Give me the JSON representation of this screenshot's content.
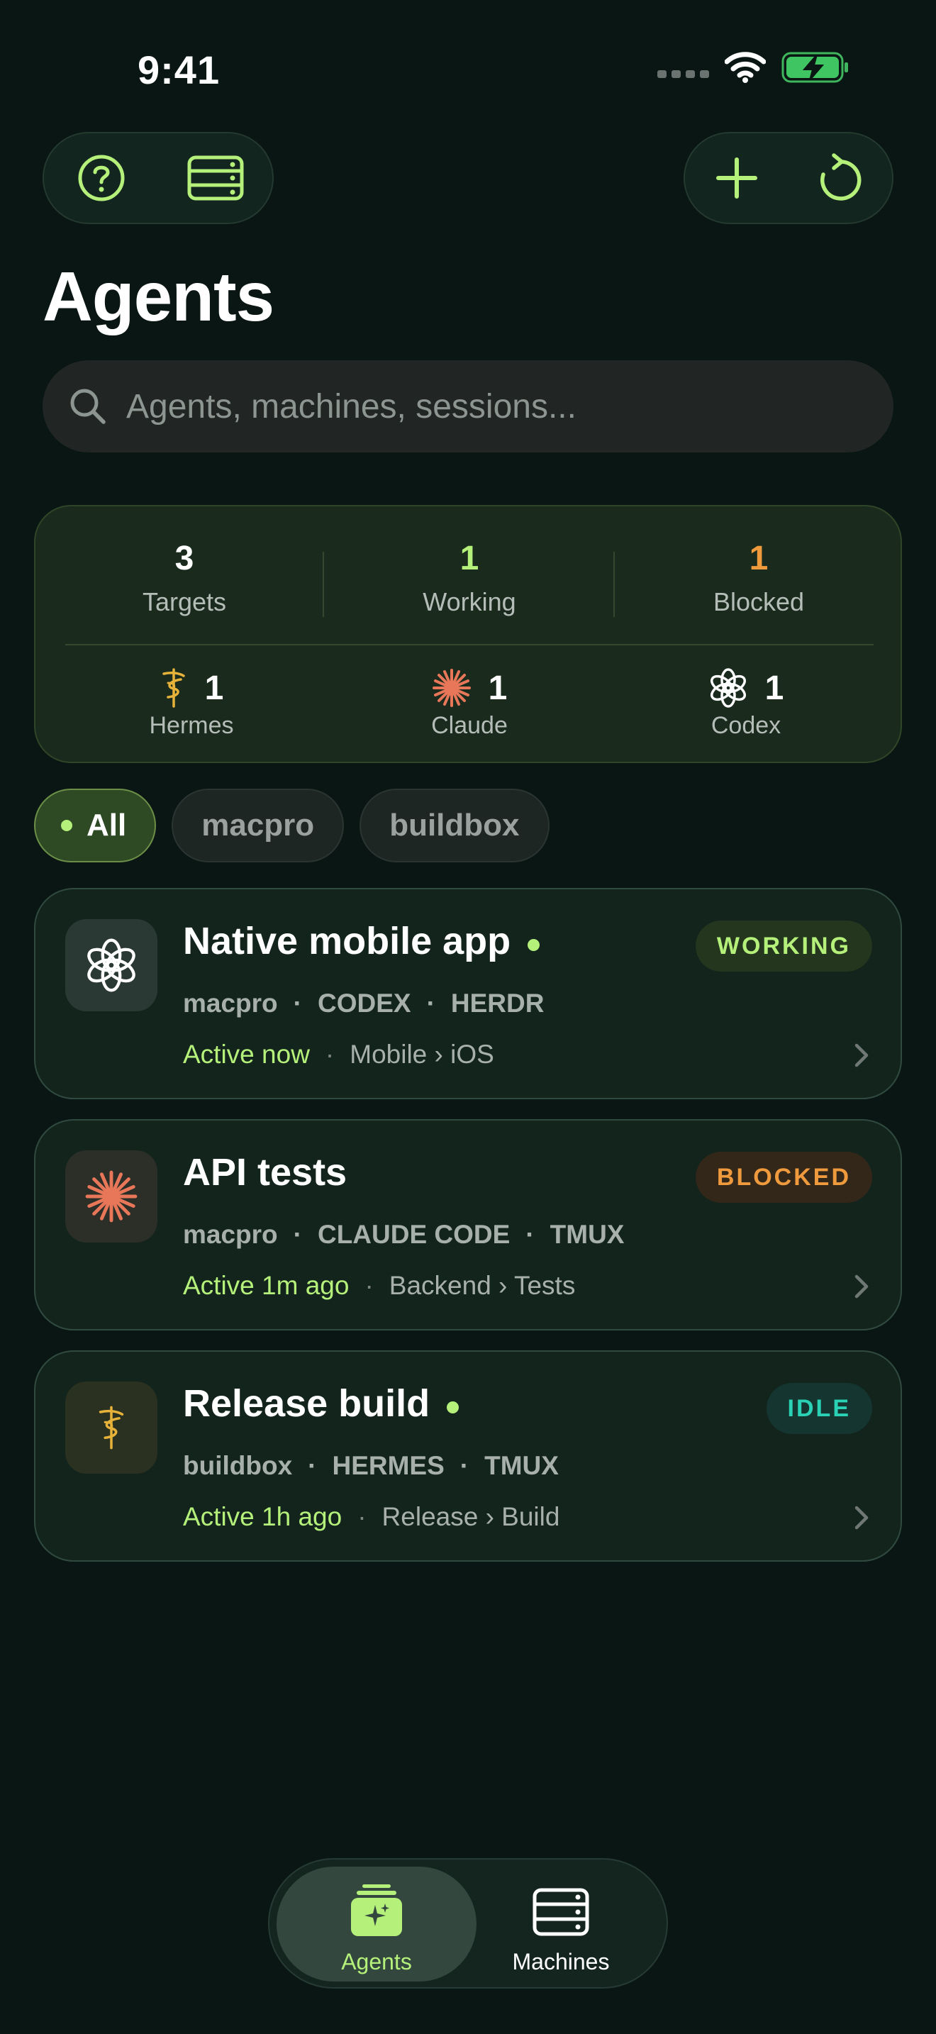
{
  "status_bar": {
    "time": "9:41"
  },
  "header": {
    "title": "Agents"
  },
  "search": {
    "placeholder": "Agents, machines, sessions..."
  },
  "stats": [
    {
      "value": "3",
      "label": "Targets",
      "color": "#ffffff"
    },
    {
      "value": "1",
      "label": "Working",
      "color": "#b4f07a"
    },
    {
      "value": "1",
      "label": "Blocked",
      "color": "#f09a3e"
    }
  ],
  "agent_counts": [
    {
      "value": "1",
      "label": "Hermes",
      "icon": "caduceus-icon"
    },
    {
      "value": "1",
      "label": "Claude",
      "icon": "claude-burst-icon"
    },
    {
      "value": "1",
      "label": "Codex",
      "icon": "openai-knot-icon"
    }
  ],
  "filters": [
    {
      "label": "All",
      "active": true
    },
    {
      "label": "macpro",
      "active": false
    },
    {
      "label": "buildbox",
      "active": false
    }
  ],
  "sessions": [
    {
      "title": "Native mobile app",
      "machine": "macpro",
      "agent": "CODEX",
      "terminal": "HERDR",
      "activity": "Active now",
      "path": "Mobile › iOS",
      "status": "WORKING",
      "icon": "openai-knot-icon",
      "live": true
    },
    {
      "title": "API tests",
      "machine": "macpro",
      "agent": "CLAUDE CODE",
      "terminal": "TMUX",
      "activity": "Active 1m ago",
      "path": "Backend › Tests",
      "status": "BLOCKED",
      "icon": "claude-burst-icon",
      "live": false
    },
    {
      "title": "Release build",
      "machine": "buildbox",
      "agent": "HERMES",
      "terminal": "TMUX",
      "activity": "Active 1h ago",
      "path": "Release › Build",
      "status": "IDLE",
      "icon": "caduceus-icon",
      "live": true
    }
  ],
  "separator": "·",
  "tabs": [
    {
      "label": "Agents",
      "icon": "agents-sparkle-icon",
      "active": true
    },
    {
      "label": "Machines",
      "icon": "server-rack-icon",
      "active": false
    }
  ],
  "colors": {
    "accent": "#b4f07a",
    "blocked": "#f09a3e",
    "idle": "#2ad1b5",
    "background": "#0a1613"
  }
}
